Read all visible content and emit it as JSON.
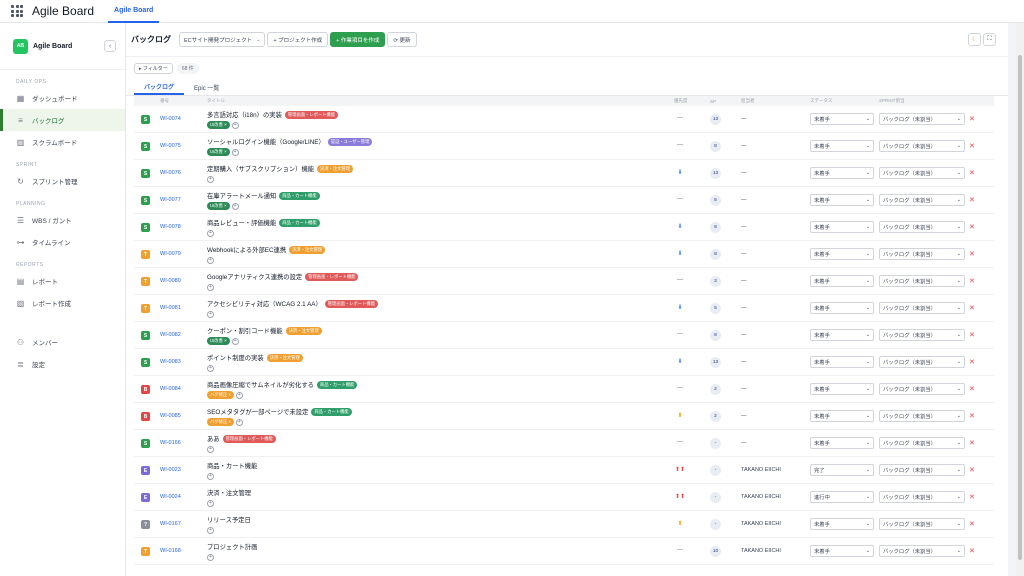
{
  "topbar": {
    "app_title": "Agile Board",
    "tab_label": "Agile Board"
  },
  "sidebar": {
    "logo_text": "AB",
    "title": "Agile Board",
    "collapse_icon": "‹",
    "sections": [
      {
        "label": "DAILY OPS",
        "items": [
          {
            "label": "ダッシュボード",
            "icon": "grid-icon",
            "glyph": "▦",
            "active": false
          },
          {
            "label": "バックログ",
            "icon": "list-icon",
            "glyph": "≡",
            "active": true
          },
          {
            "label": "スクラムボード",
            "icon": "board-icon",
            "glyph": "▥",
            "active": false
          }
        ]
      },
      {
        "label": "SPRINT",
        "items": [
          {
            "label": "スプリント管理",
            "icon": "sync-icon",
            "glyph": "↻",
            "active": false
          }
        ]
      },
      {
        "label": "PLANNING",
        "items": [
          {
            "label": "WBS / ガント",
            "icon": "gantt-icon",
            "glyph": "☰",
            "active": false
          },
          {
            "label": "タイムライン",
            "icon": "timeline-icon",
            "glyph": "⊶",
            "active": false
          }
        ]
      },
      {
        "label": "REPORTS",
        "items": [
          {
            "label": "レポート",
            "icon": "report-icon",
            "glyph": "▤",
            "active": false
          },
          {
            "label": "レポート作成",
            "icon": "report-create-icon",
            "glyph": "▧",
            "active": false
          }
        ]
      },
      {
        "label": "",
        "items": [
          {
            "label": "メンバー",
            "icon": "members-icon",
            "glyph": "⚇",
            "active": false
          },
          {
            "label": "設定",
            "icon": "settings-icon",
            "glyph": "≣",
            "active": false
          }
        ]
      }
    ]
  },
  "toolbar": {
    "page_title": "バックログ",
    "project_select": "ECサイト開発プロジェクト",
    "create_project": "+ プロジェクト作成",
    "create_item": "+ 作業項目を作成",
    "refresh": "⟳ 更新",
    "theme_icon": "☾",
    "fullscreen_icon": "⛶"
  },
  "filter": {
    "label": "▸ フィルター",
    "count": "68 件"
  },
  "tabs": [
    "バックログ",
    "Epic 一覧"
  ],
  "columns": {
    "num": "番号",
    "title": "タイトル",
    "priority": "優先度",
    "sp": "SP",
    "assignee": "担当者",
    "status": "ステータス",
    "sprint": "SPRINT割当"
  },
  "colors": {
    "story": "#2e9e4f",
    "task": "#f0a030",
    "bug": "#e04848",
    "epic": "#7c6bd6",
    "unknown": "#8a8f98",
    "epic_report": "#e05a5a",
    "epic_auth": "#8b7bd8",
    "epic_payment": "#f0a030",
    "epic_cart": "#2e9e6a",
    "label_ui": "#2e8b57",
    "label_bug": "#f0a030",
    "priority_low": "#3b82f6",
    "priority_high": "#ef4444",
    "priority_mid": "#f59e0b"
  },
  "rows": [
    {
      "type": "S",
      "num": "WI-0074",
      "title": "多言語対応（i18n）の実装",
      "epic": "管理画面・レポート機能",
      "epic_color": "#e05a5a",
      "labels": [
        "UI改善 ×"
      ],
      "label_color": "#2e8b57",
      "priority": "—",
      "sp": "13",
      "assignee": "—",
      "status": "未着手",
      "sprint": "バックログ（未割当）"
    },
    {
      "type": "S",
      "num": "WI-0075",
      "title": "ソーシャルログイン機能（Google/LINE）",
      "epic": "認証・ユーザー管理",
      "epic_color": "#8b7bd8",
      "labels": [
        "UI改善 ×"
      ],
      "label_color": "#2e8b57",
      "priority": "—",
      "sp": "8",
      "assignee": "—",
      "status": "未着手",
      "sprint": "バックログ（未割当）"
    },
    {
      "type": "S",
      "num": "WI-0076",
      "title": "定期購入（サブスクリプション）機能",
      "epic": "決済・注文管理",
      "epic_color": "#f0a030",
      "labels": [],
      "label_color": "",
      "priority": "⬇",
      "sp": "13",
      "assignee": "—",
      "status": "未着手",
      "sprint": "バックログ（未割当）"
    },
    {
      "type": "S",
      "num": "WI-0077",
      "title": "在庫アラートメール通知",
      "epic": "商品・カート機能",
      "epic_color": "#2e9e6a",
      "labels": [
        "UI改善 ×"
      ],
      "label_color": "#2e8b57",
      "priority": "—",
      "sp": "5",
      "assignee": "—",
      "status": "未着手",
      "sprint": "バックログ（未割当）"
    },
    {
      "type": "S",
      "num": "WI-0078",
      "title": "商品レビュー・評価機能",
      "epic": "商品・カート機能",
      "epic_color": "#2e9e6a",
      "labels": [],
      "label_color": "",
      "priority": "⬇",
      "sp": "8",
      "assignee": "—",
      "status": "未着手",
      "sprint": "バックログ（未割当）"
    },
    {
      "type": "T",
      "num": "WI-0079",
      "title": "Webhookによる外部EC連携",
      "epic": "決済・注文管理",
      "epic_color": "#f0a030",
      "labels": [],
      "label_color": "",
      "priority": "⬇",
      "sp": "8",
      "assignee": "—",
      "status": "未着手",
      "sprint": "バックログ（未割当）"
    },
    {
      "type": "T",
      "num": "WI-0080",
      "title": "Googleアナリティクス連携の設定",
      "epic": "管理画面・レポート機能",
      "epic_color": "#e05a5a",
      "labels": [],
      "label_color": "",
      "priority": "—",
      "sp": "3",
      "assignee": "—",
      "status": "未着手",
      "sprint": "バックログ（未割当）"
    },
    {
      "type": "T",
      "num": "WI-0081",
      "title": "アクセシビリティ対応（WCAG 2.1 AA）",
      "epic": "管理画面・レポート機能",
      "epic_color": "#e05a5a",
      "labels": [],
      "label_color": "",
      "priority": "⬇",
      "sp": "5",
      "assignee": "—",
      "status": "未着手",
      "sprint": "バックログ（未割当）"
    },
    {
      "type": "S",
      "num": "WI-0082",
      "title": "クーポン・割引コード機能",
      "epic": "決済・注文管理",
      "epic_color": "#f0a030",
      "labels": [
        "UI改善 ×"
      ],
      "label_color": "#2e8b57",
      "priority": "—",
      "sp": "8",
      "assignee": "—",
      "status": "未着手",
      "sprint": "バックログ（未割当）"
    },
    {
      "type": "S",
      "num": "WI-0083",
      "title": "ポイント制度の実装",
      "epic": "決済・注文管理",
      "epic_color": "#f0a030",
      "labels": [],
      "label_color": "",
      "priority": "⬇",
      "sp": "13",
      "assignee": "—",
      "status": "未着手",
      "sprint": "バックログ（未割当）"
    },
    {
      "type": "B",
      "num": "WI-0084",
      "title": "商品画像圧縮でサムネイルが劣化する",
      "epic": "商品・カート機能",
      "epic_color": "#2e9e6a",
      "labels": [
        "バグ修正 ×"
      ],
      "label_color": "#f0a030",
      "priority": "—",
      "sp": "2",
      "assignee": "—",
      "status": "未着手",
      "sprint": "バックログ（未割当）"
    },
    {
      "type": "B",
      "num": "WI-0085",
      "title": "SEOメタタグが一部ページで未設定",
      "epic": "商品・カート機能",
      "epic_color": "#2e9e6a",
      "labels": [
        "バグ修正 ×"
      ],
      "label_color": "#f0a030",
      "priority": "⬆",
      "sp": "2",
      "assignee": "—",
      "status": "未着手",
      "sprint": "バックログ（未割当）"
    },
    {
      "type": "S",
      "num": "WI-0166",
      "title": "ああ",
      "epic": "管理画面・レポート機能",
      "epic_color": "#e05a5a",
      "labels": [],
      "label_color": "",
      "priority": "—",
      "sp": "-",
      "assignee": "—",
      "status": "未着手",
      "sprint": "バックログ（未割当）"
    },
    {
      "type": "E",
      "num": "WI-0023",
      "title": "商品・カート機能",
      "epic": "",
      "epic_color": "",
      "labels": [],
      "label_color": "",
      "priority": "⬆⬆",
      "sp": "-",
      "assignee": "TAKANO EIICHI",
      "status": "完了",
      "sprint": "バックログ（未割当）"
    },
    {
      "type": "E",
      "num": "WI-0024",
      "title": "決済・注文管理",
      "epic": "",
      "epic_color": "",
      "labels": [],
      "label_color": "",
      "priority": "⬆⬆",
      "sp": "-",
      "assignee": "TAKANO EIICHI",
      "status": "進行中",
      "sprint": "バックログ（未割当）"
    },
    {
      "type": "?",
      "num": "WI-0167",
      "title": "リリース予定日",
      "epic": "",
      "epic_color": "",
      "labels": [],
      "label_color": "",
      "priority": "⬆",
      "sp": "-",
      "assignee": "TAKANO EIICHI",
      "status": "未着手",
      "sprint": "バックログ（未割当）"
    },
    {
      "type": "T",
      "num": "WI-0168",
      "title": "プロジェクト計画",
      "epic": "",
      "epic_color": "",
      "labels": [],
      "label_color": "",
      "priority": "—",
      "sp": "10",
      "assignee": "TAKANO EIICHI",
      "status": "未着手",
      "sprint": "バックログ（未割当）"
    }
  ]
}
